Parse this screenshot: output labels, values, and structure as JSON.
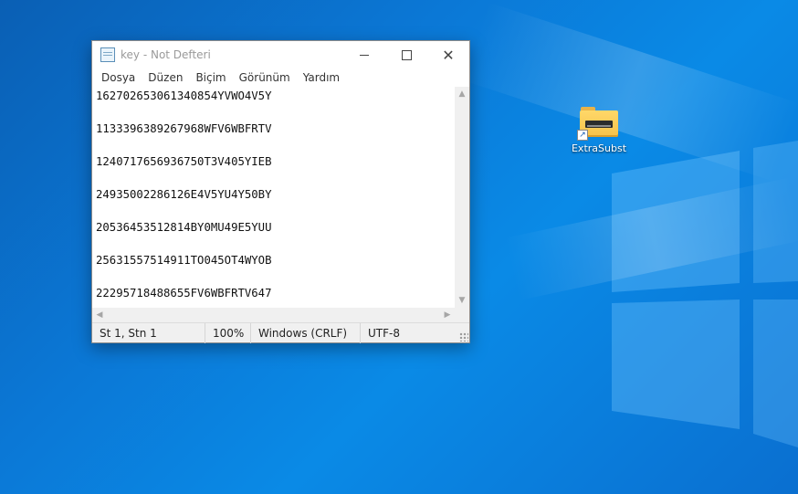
{
  "notepad": {
    "title": "key - Not Defteri",
    "menu": [
      "Dosya",
      "Düzen",
      "Biçim",
      "Görünüm",
      "Yardım"
    ],
    "lines": [
      "162702653061340854YVWO4V5Y",
      "",
      "1133396389267968WFV6WBFRTV",
      "",
      "1240717656936750T3V405YIEB",
      "",
      "24935002286126E4V5YU4Y50BY",
      "",
      "20536453512814BY0MU49E5YUU",
      "",
      "25631557514911TO045OT4WYOB",
      "",
      "22295718488655FV6WBFRTV647"
    ],
    "status": {
      "position": "St 1, Stn 1",
      "zoom": "100%",
      "line_ending": "Windows (CRLF)",
      "encoding": "UTF-8"
    }
  },
  "desktop": {
    "icons": [
      {
        "label": "ExtraSubst",
        "icon": "folder-shortcut-icon"
      }
    ]
  }
}
